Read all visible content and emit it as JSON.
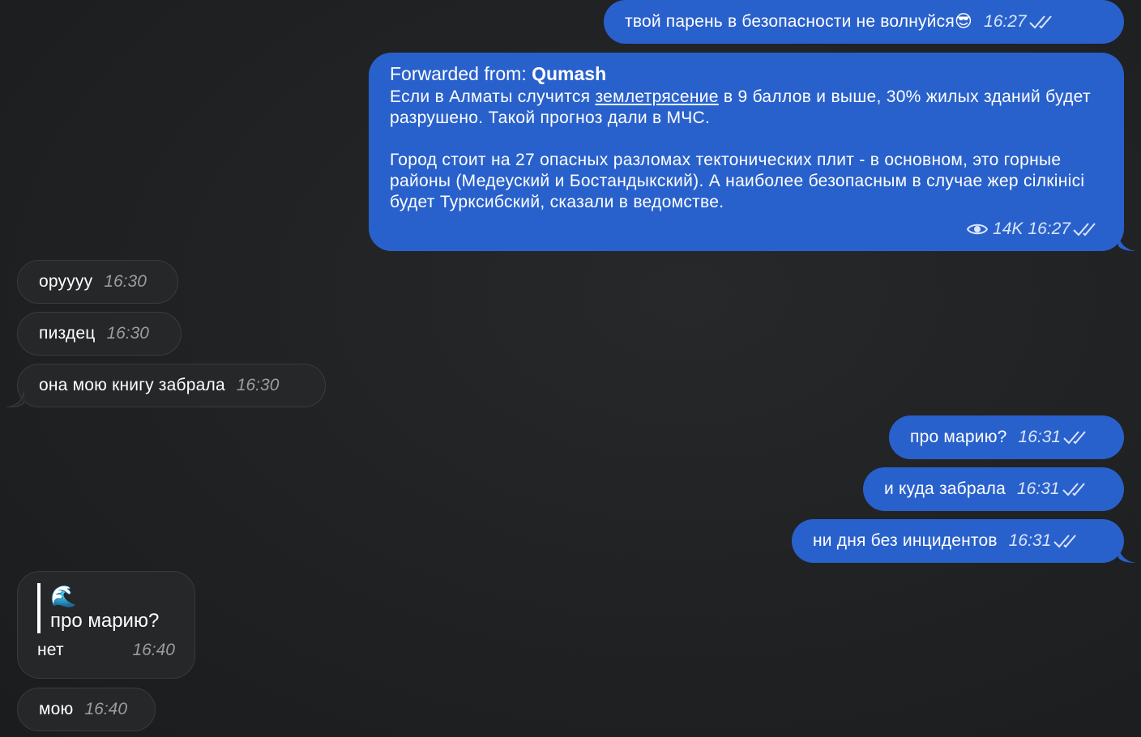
{
  "messages": [
    {
      "dir": "out",
      "text": "твой парень в безопасности не волнуйся😎",
      "time": "16:27"
    },
    {
      "dir": "out",
      "type": "forward",
      "forwarded_label": "Forwarded from:",
      "forwarded_from": "Qumash",
      "p1_before": "Если в Алматы случится ",
      "p1_link": "землетрясение",
      "p1_after": " в 9 баллов и выше, 30% жилых зданий будет разрушено. Такой прогноз дали в МЧС.",
      "p2": "Город стоит на 27 опасных разломах тектонических плит - в основном, это горные районы (Медеуский и Бостандыкский). А наиболее безопасным в случае жер сілкінісі будет Турксибский, сказали в ведомстве.",
      "views": "14K",
      "time": "16:27"
    },
    {
      "dir": "in",
      "text": "оруууу",
      "time": "16:30"
    },
    {
      "dir": "in",
      "text": "пиздец",
      "time": "16:30"
    },
    {
      "dir": "in",
      "text": "она мою книгу забрала",
      "time": "16:30"
    },
    {
      "dir": "out",
      "text": "про марию?",
      "time": "16:31"
    },
    {
      "dir": "out",
      "text": "и куда забрала",
      "time": "16:31"
    },
    {
      "dir": "out",
      "text": "ни дня без инцидентов",
      "time": "16:31"
    },
    {
      "dir": "in",
      "type": "reply",
      "quote_emoji": "🌊",
      "quote_text": "про марию?",
      "text": "нет",
      "time": "16:40"
    },
    {
      "dir": "in",
      "text": "мою",
      "time": "16:40"
    }
  ],
  "icons": {
    "read": "double-check-icon",
    "views": "eye-icon",
    "quote": "wave-emoji"
  },
  "colors": {
    "outgoing": "#2961cc",
    "incoming": "#262729",
    "background": "#1f2123"
  }
}
